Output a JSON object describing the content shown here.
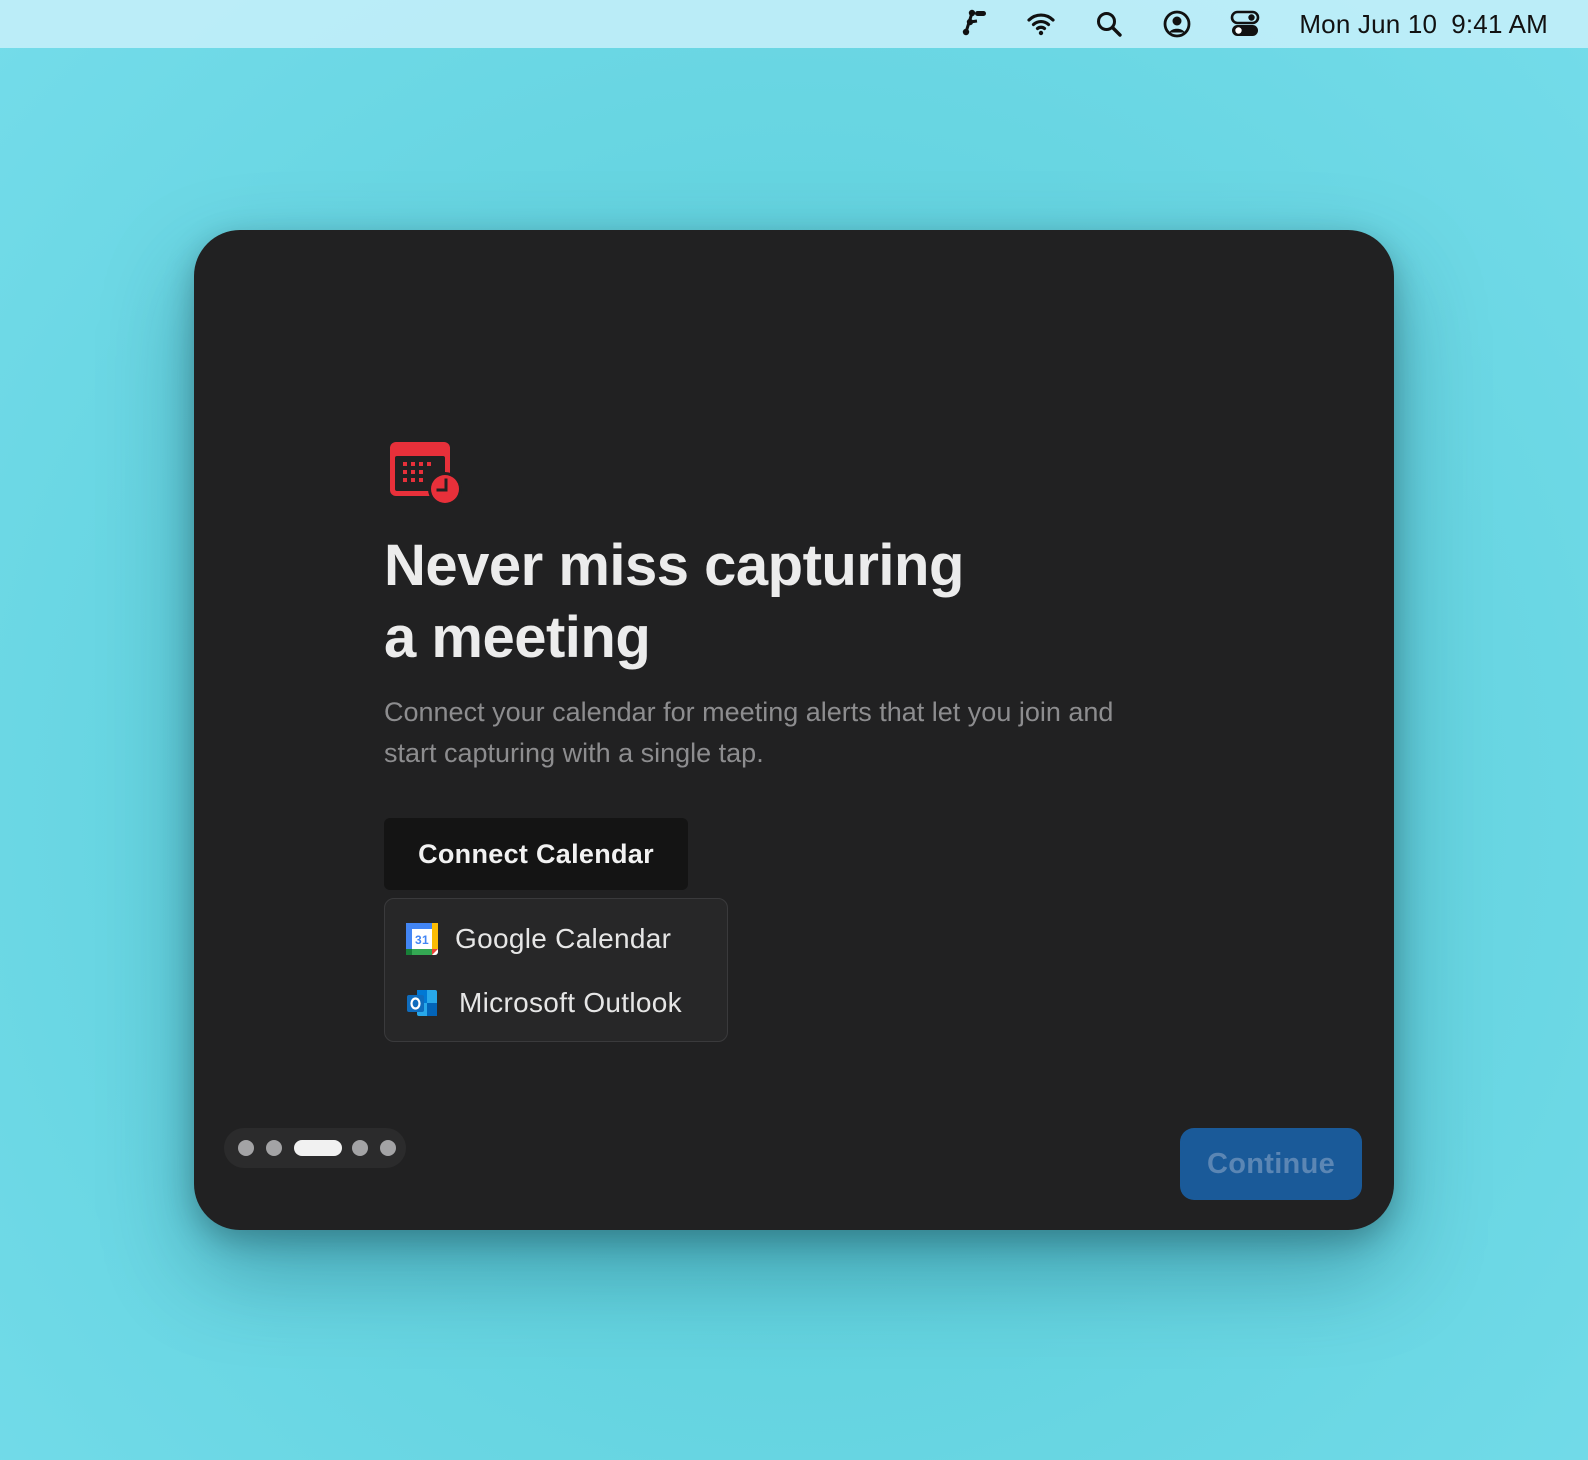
{
  "menubar": {
    "icons": [
      "app-status-icon",
      "wifi-icon",
      "search-icon",
      "user-account-icon",
      "control-center-icon"
    ],
    "date": "Mon Jun 10",
    "time": "9:41 AM"
  },
  "onboarding": {
    "app_icon": "calendar-clock-icon",
    "title_line1": "Never miss capturing",
    "title_line2": "a meeting",
    "subtitle_line1": "Connect your calendar for meeting alerts that let you join and",
    "subtitle_line2": "start capturing with a single tap.",
    "connect_button_label": "Connect Calendar",
    "providers": [
      {
        "label": "Google Calendar",
        "icon": "google-calendar-icon"
      },
      {
        "label": "Microsoft Outlook",
        "icon": "microsoft-outlook-icon"
      }
    ],
    "pager": {
      "total": 5,
      "current": 3
    },
    "continue_label": "Continue",
    "colors": {
      "accent_red": "#e8303a",
      "continue_bg": "#1a5a99",
      "window_bg": "#212122"
    }
  }
}
